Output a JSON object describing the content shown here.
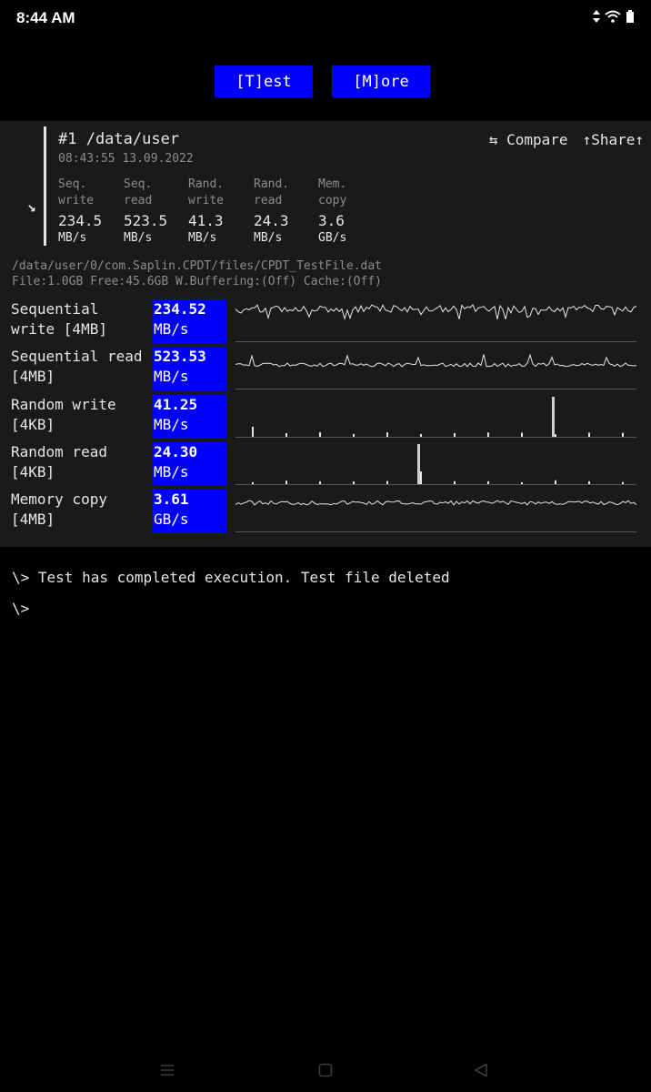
{
  "status_bar": {
    "time": "8:44 AM",
    "icons": [
      "data-arrows-icon",
      "wifi-icon",
      "battery-icon"
    ]
  },
  "top_buttons": {
    "test": "[T]est",
    "more": "[M]ore"
  },
  "result": {
    "title": "#1 /data/user",
    "timestamp": "08:43:55 13.09.2022",
    "compare": "⇆ Compare",
    "share": "↑Share↑",
    "metrics": [
      {
        "l1": "Seq.",
        "l2": "write",
        "value": "234.5",
        "unit": "MB/s"
      },
      {
        "l1": "Seq.",
        "l2": "read",
        "value": "523.5",
        "unit": "MB/s"
      },
      {
        "l1": "Rand.",
        "l2": "write",
        "value": "41.3",
        "unit": "MB/s"
      },
      {
        "l1": "Rand.",
        "l2": "read",
        "value": "24.3",
        "unit": "MB/s"
      },
      {
        "l1": "Mem.",
        "l2": "copy",
        "value": "3.6",
        "unit": "GB/s"
      }
    ]
  },
  "file_info": {
    "path": "/data/user/0/com.Saplin.CPDT/files/CPDT_TestFile.dat",
    "details": "File:1.0GB Free:45.6GB W.Buffering:(Off) Cache:(Off)"
  },
  "tests": [
    {
      "name": "Sequential\nwrite [4MB]",
      "value": "234.52",
      "unit": "MB/s",
      "graph": "line"
    },
    {
      "name": "Sequential read\n[4MB]",
      "value": "523.53",
      "unit": "MB/s",
      "graph": "line"
    },
    {
      "name": "Random write\n[4KB]",
      "value": "41.25",
      "unit": "MB/s",
      "graph": "bars"
    },
    {
      "name": "Random read\n[4KB]",
      "value": "24.30",
      "unit": "MB/s",
      "graph": "bars"
    },
    {
      "name": "Memory copy\n[4MB]",
      "value": "3.61",
      "unit": "GB/s",
      "graph": "line"
    }
  ],
  "console": {
    "line1": "\\> Test has completed execution. Test file deleted",
    "line2": "\\>"
  },
  "nav_bar": [
    "menu-icon",
    "home-icon",
    "back-icon"
  ]
}
